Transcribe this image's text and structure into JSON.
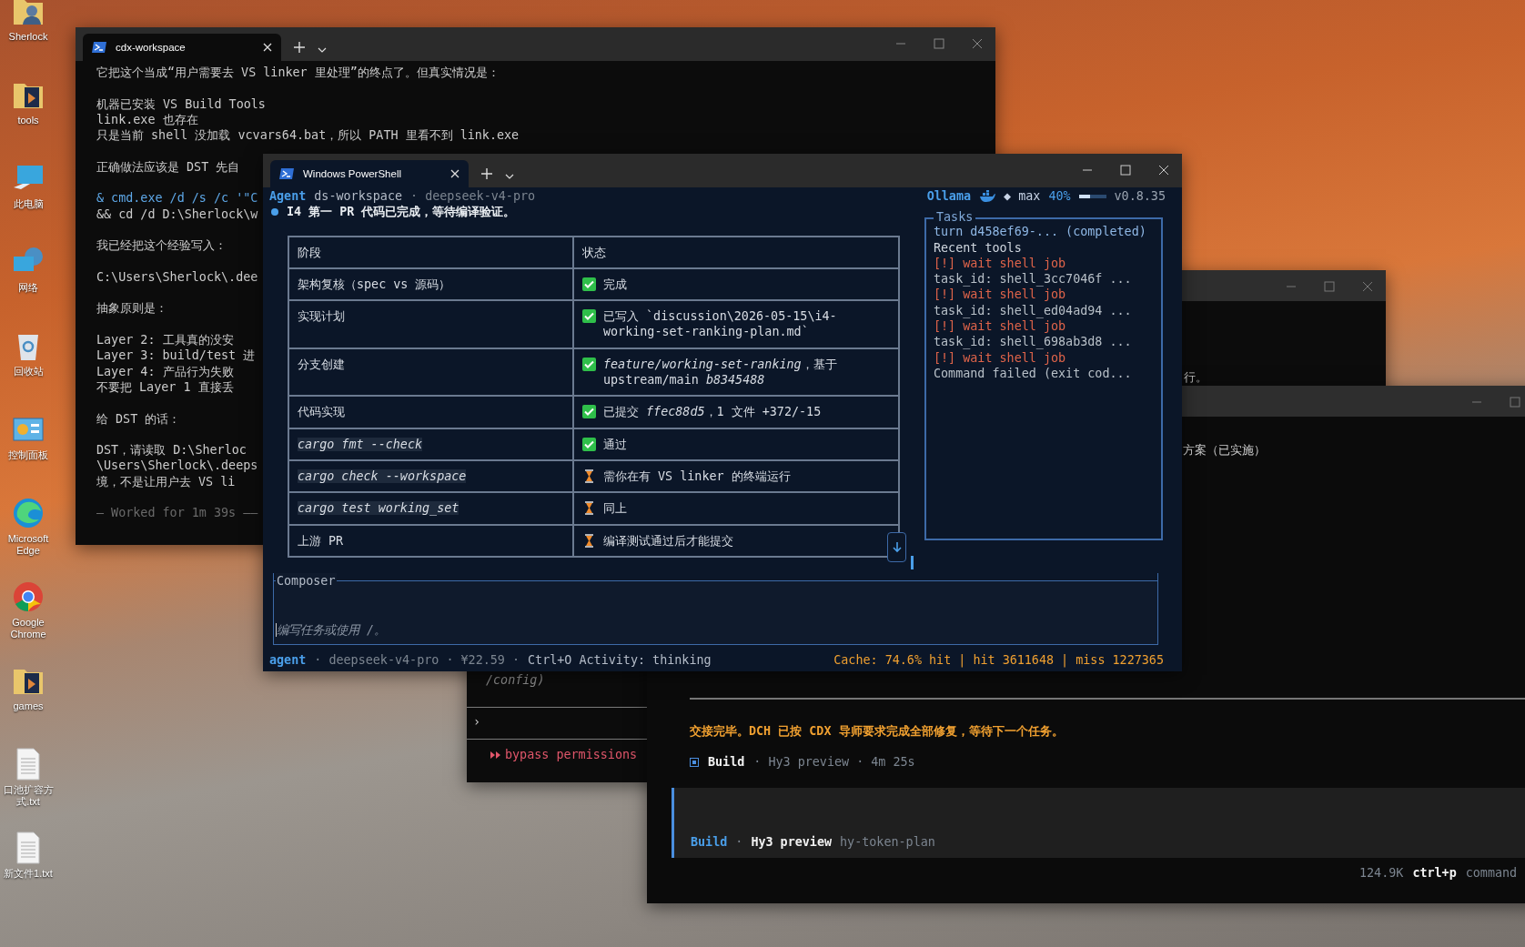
{
  "desktop_icons": [
    {
      "label": "Sherlock",
      "kind": "user"
    },
    {
      "label": "tools",
      "kind": "folder"
    },
    {
      "label": "此电脑",
      "kind": "computer"
    },
    {
      "label": "网络",
      "kind": "network"
    },
    {
      "label": "回收站",
      "kind": "recycle"
    },
    {
      "label": "控制面板",
      "kind": "control"
    },
    {
      "label": "Microsoft Edge",
      "kind": "edge"
    },
    {
      "label": "Google Chrome",
      "kind": "chrome"
    },
    {
      "label": "games",
      "kind": "folder"
    },
    {
      "label": "口池扩容方式.txt",
      "kind": "text"
    },
    {
      "label": "新文件1.txt",
      "kind": "text"
    }
  ],
  "back_terminal": {
    "tab_title": "cdx-workspace",
    "paragraphs": [
      [
        {
          "text": "它把这个当成“用户需要去 VS linker 里处理”的终点了。但真实情况是：",
          "kind": "plain"
        }
      ],
      [
        {
          "text": "机器已安装 VS Build Tools",
          "kind": "plain"
        },
        {
          "text": "link.exe 也存在",
          "kind": "plain"
        },
        {
          "text": "只是当前 shell 没加载 vcvars64.bat，所以 PATH 里看不到 link.exe",
          "kind": "plain"
        }
      ],
      [
        {
          "text": "正确做法应该是 DST 先自",
          "kind": "plain"
        }
      ],
      [
        {
          "text": "& cmd.exe /d /s /c '\"C",
          "kind": "command"
        },
        {
          "text": "&& cd /d D:\\Sherlock\\w",
          "kind": "plain"
        }
      ],
      [
        {
          "text": "我已经把这个经验写入：",
          "kind": "plain"
        }
      ],
      [
        {
          "text": "C:\\Users\\Sherlock\\.dee",
          "kind": "plain"
        }
      ],
      [
        {
          "text": "抽象原则是：",
          "kind": "plain"
        }
      ],
      [
        {
          "text": "Layer 2: 工具真的没安",
          "kind": "plain"
        },
        {
          "text": "Layer 3: build/test 进",
          "kind": "plain"
        },
        {
          "text": "Layer 4: 产品行为失败",
          "kind": "plain"
        },
        {
          "text": "不要把 Layer 1 直接丢",
          "kind": "plain"
        }
      ],
      [
        {
          "text": "给 DST 的话：",
          "kind": "plain"
        }
      ],
      [
        {
          "text": "DST，请读取 D:\\Sherloc",
          "kind": "plain"
        },
        {
          "text": "\\Users\\Sherlock\\.deeps",
          "kind": "plain"
        },
        {
          "text": "境，不是让用户去 VS li",
          "kind": "plain"
        }
      ],
      [
        {
          "text": "— Worked for 1m 39s ——",
          "kind": "muted"
        }
      ]
    ]
  },
  "middle_terminal": {
    "visible_text": "行。",
    "config_line": "/config)",
    "prompt": "›",
    "permission": "bypass permissions"
  },
  "right_terminal": {
    "visible_text": "方案（已实施）",
    "handoff": "交接完毕。DCH 已按 CDX 导师要求完成全部修复，等待下一个任务。",
    "build_line": [
      {
        "text": "Build",
        "kind": "strong"
      },
      {
        "text": "· Hy3 preview · 4m 25s",
        "kind": "muted"
      }
    ],
    "input_footer": [
      {
        "text": "Build",
        "kind": "accent"
      },
      {
        "text": "·",
        "kind": "muted"
      },
      {
        "text": "Hy3 preview",
        "kind": "strong"
      },
      {
        "text": "hy-token-plan",
        "kind": "muted"
      }
    ],
    "tokens": "124.9K",
    "shortcut_key": "ctrl+p",
    "shortcut_label": "command"
  },
  "powershell": {
    "tab_title": "Windows PowerShell",
    "header_left": [
      {
        "text": "Agent",
        "kind": "accent"
      },
      {
        "text": "ds-workspace",
        "kind": "meta"
      },
      {
        "text": "· deepseek-v4-pro",
        "kind": "muted"
      }
    ],
    "header_right": {
      "provider": "Ollama",
      "effort": "◆ max",
      "context": "40%",
      "level": 0.4,
      "version": "v0.8.35"
    },
    "message": "I4 第一 PR 代码已完成，等待编译验证。",
    "table": {
      "columns": [
        "阶段",
        "状态"
      ],
      "rows": [
        {
          "stage": "架构复核（spec vs 源码）",
          "code": false,
          "kind": "done",
          "detail": "完成"
        },
        {
          "stage": "实现计划",
          "code": false,
          "kind": "done",
          "detail": "已写入 `discussion\\2026-05-15\\i4-working-set-ranking-plan.md`"
        },
        {
          "stage": "分支创建",
          "code": false,
          "kind": "done",
          "detail": "*feature/working-set-ranking*，基于 upstream/main *b8345488*"
        },
        {
          "stage": "代码实现",
          "code": false,
          "kind": "done",
          "detail": "已提交 *ffec88d5*，1 文件 +372/-15"
        },
        {
          "stage": "cargo fmt --check",
          "code": true,
          "kind": "done",
          "detail": "通过"
        },
        {
          "stage": "cargo check --workspace",
          "code": true,
          "kind": "pending",
          "detail": "需你在有 VS linker 的终端运行"
        },
        {
          "stage": "cargo test working_set",
          "code": true,
          "kind": "pending",
          "detail": "同上"
        },
        {
          "stage": "上游 PR",
          "code": false,
          "kind": "pending",
          "detail": "编译测试通过后才能提交"
        }
      ]
    },
    "tasks": {
      "title": "Tasks",
      "items": [
        {
          "text": "turn d458ef69-... (completed)",
          "kind": "turn"
        },
        {
          "text": "Recent tools",
          "kind": "heading"
        },
        {
          "text": "[!] wait shell job",
          "kind": "warning"
        },
        {
          "text": "task_id: shell_3cc7046f ...",
          "kind": "detail"
        },
        {
          "text": "[!] wait shell job",
          "kind": "warning"
        },
        {
          "text": "task_id: shell_ed04ad94 ...",
          "kind": "detail"
        },
        {
          "text": "[!] wait shell job",
          "kind": "warning"
        },
        {
          "text": "task_id: shell_698ab3d8 ...",
          "kind": "detail"
        },
        {
          "text": "[!] wait shell job",
          "kind": "warning"
        },
        {
          "text": "Command failed (exit cod...",
          "kind": "detail"
        }
      ]
    },
    "composer": {
      "label": "Composer",
      "placeholder": "编写任务或使用 /。"
    },
    "status_left": [
      {
        "text": "agent",
        "kind": "accent"
      },
      {
        "text": "· deepseek-v4-pro · ¥22.59 ·",
        "kind": "muted"
      },
      {
        "text": "Ctrl+O Activity: thinking",
        "kind": "meta"
      }
    ],
    "status_right": "Cache: 74.6% hit | hit 3611648 | miss 1227365"
  }
}
